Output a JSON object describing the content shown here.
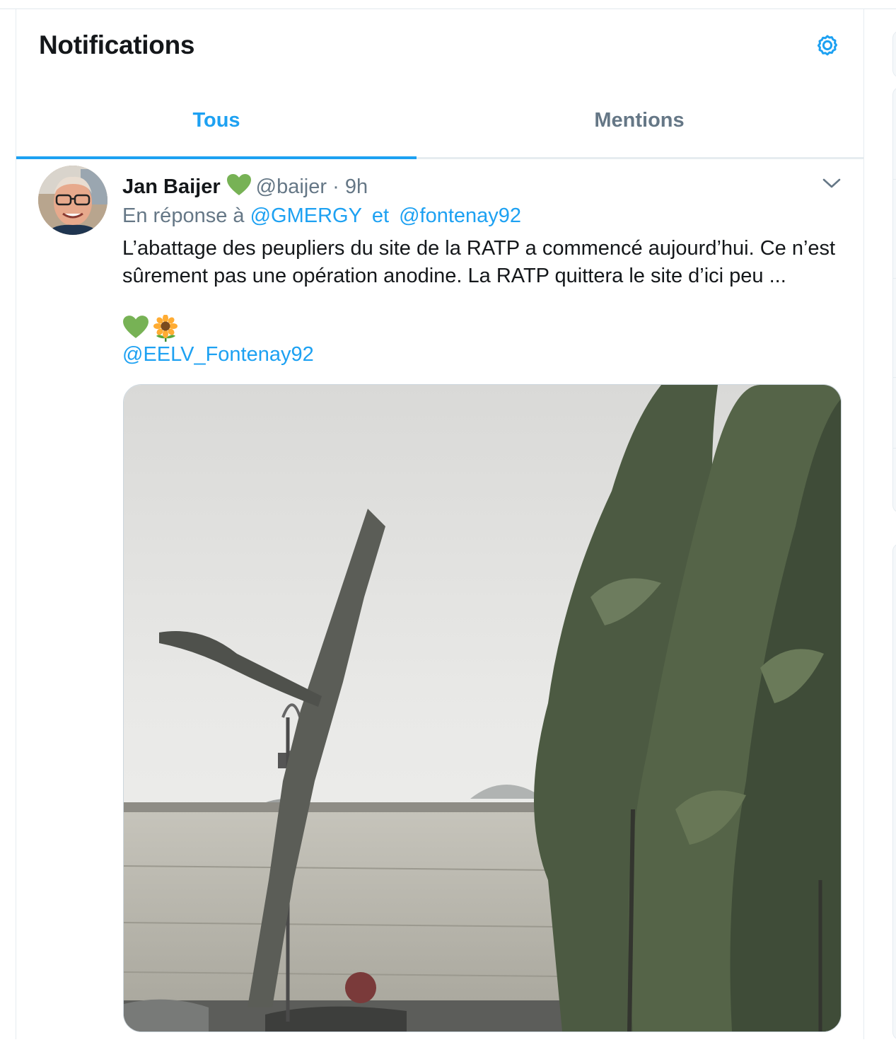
{
  "header": {
    "title": "Notifications",
    "settings_icon": "gear-icon"
  },
  "tabs": [
    {
      "label": "Tous",
      "active": true
    },
    {
      "label": "Mentions",
      "active": false
    }
  ],
  "colors": {
    "accent": "#1da1f2",
    "text_primary": "#14171a",
    "text_secondary": "#657786",
    "heart": "#77b255"
  },
  "tweet": {
    "author_name": "Jan Baijer",
    "author_badge": "green-heart-emoji",
    "handle": "@baijer",
    "separator": "·",
    "time": "9h",
    "reply_prefix": "En réponse à",
    "reply_to": [
      "@GMERGY",
      "@fontenay92"
    ],
    "reply_joiner": "et",
    "text": "L’abattage des peupliers du site de la RATP a commencé aujourd’hui. Ce n’est sûrement pas une opération anodine. La RATP quittera le site d’ici peu ...",
    "emojis": [
      "green-heart-emoji",
      "sunflower-emoji"
    ],
    "mention": "@EELV_Fontenay92",
    "menu_icon": "chevron-down-icon",
    "media_icon": "video-thumbnail"
  }
}
